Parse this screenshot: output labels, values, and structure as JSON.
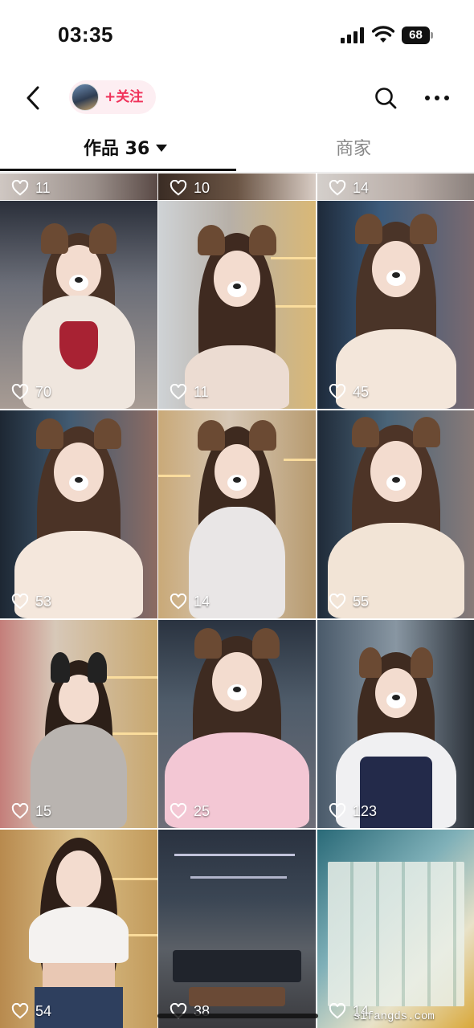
{
  "status_bar": {
    "time": "03:35",
    "battery": "68"
  },
  "nav": {
    "follow_label": "+关注"
  },
  "tabs": [
    {
      "label": "作品 36"
    },
    {
      "label": "商家"
    }
  ],
  "videos": [
    {
      "likes": "11"
    },
    {
      "likes": "10"
    },
    {
      "likes": "14"
    },
    {
      "likes": "70"
    },
    {
      "likes": "11"
    },
    {
      "likes": "45"
    },
    {
      "likes": "53"
    },
    {
      "likes": "14"
    },
    {
      "likes": "55"
    },
    {
      "likes": "15"
    },
    {
      "likes": "25"
    },
    {
      "likes": "123"
    },
    {
      "likes": "54"
    },
    {
      "likes": "38"
    },
    {
      "likes": "14"
    }
  ],
  "watermark": "sifangds.com",
  "colors": {
    "accent": "#f0325a",
    "follow_bg": "#fdeef2"
  }
}
